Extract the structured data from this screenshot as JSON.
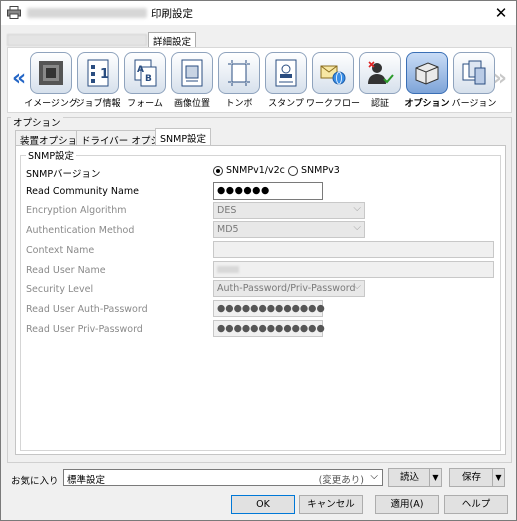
{
  "window": {
    "title": "印刷設定",
    "top_tab": "詳細設定"
  },
  "toolbar": {
    "items": [
      {
        "label": "イメージング",
        "icon": "imaging-icon"
      },
      {
        "label": "ジョブ情報",
        "icon": "job-info-icon"
      },
      {
        "label": "フォーム",
        "icon": "form-icon"
      },
      {
        "label": "画像位置",
        "icon": "image-position-icon"
      },
      {
        "label": "トンボ",
        "icon": "crop-marks-icon"
      },
      {
        "label": "スタンプ",
        "icon": "stamp-icon"
      },
      {
        "label": "ワークフロー",
        "icon": "workflow-icon"
      },
      {
        "label": "認証",
        "icon": "authentication-icon"
      },
      {
        "label": "オプション",
        "icon": "options-icon"
      },
      {
        "label": "バージョン",
        "icon": "version-icon"
      }
    ],
    "left_arrow": "«",
    "right_arrow": "»"
  },
  "options": {
    "caption": "オプション",
    "tabs": [
      {
        "label": "装置オプション"
      },
      {
        "label": "ドライバー オプション"
      },
      {
        "label": "SNMP設定"
      }
    ]
  },
  "snmp": {
    "group_caption": "SNMP設定",
    "version_label": "SNMPバージョン",
    "v1v2c": "SNMPv1/v2c",
    "v3": "SNMPv3",
    "read_community_label": "Read Community Name",
    "read_community_value": "●●●●●●",
    "encryption_label": "Encryption Algorithm",
    "encryption_value": "DES",
    "auth_method_label": "Authentication Method",
    "auth_method_value": "MD5",
    "context_name_label": "Context Name",
    "read_user_label": "Read User Name",
    "security_level_label": "Security Level",
    "security_level_value": "Auth-Password/Priv-Password",
    "auth_password_label": "Read User Auth-Password",
    "auth_password_value": "●●●●●●●●●●●●●",
    "priv_password_label": "Read User Priv-Password",
    "priv_password_value": "●●●●●●●●●●●●●"
  },
  "favorites": {
    "label": "お気に入り",
    "value": "標準設定",
    "changed": "(変更あり)",
    "load": "読込",
    "save": "保存"
  },
  "buttons": {
    "ok": "OK",
    "cancel": "キャンセル",
    "apply": "適用(A)",
    "help": "ヘルプ"
  }
}
